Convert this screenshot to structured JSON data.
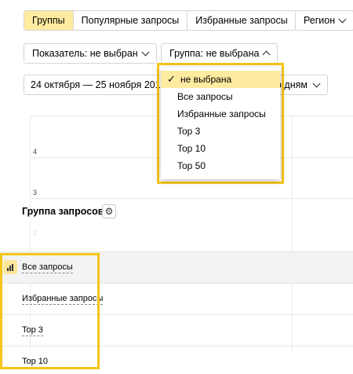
{
  "tabs": [
    {
      "label": "Группы",
      "active": true
    },
    {
      "label": "Популярные запросы",
      "active": false
    },
    {
      "label": "Избранные запросы",
      "active": false
    }
  ],
  "region_button": "Регион",
  "metric_button": "Показатель: не выбран",
  "group_button": "Группа: не выбрана",
  "date_range": "24 октября — 25 ноября 2019",
  "granularity_button_partial": "по дням",
  "chart": {
    "y_ticks": [
      "4",
      "3",
      "2"
    ]
  },
  "section_title": "Группа запросов",
  "rows": [
    {
      "label": "Все запросы",
      "selected": true
    },
    {
      "label": "Избранные запросы",
      "selected": false
    },
    {
      "label": "Top 3",
      "selected": false
    },
    {
      "label": "Top 10",
      "selected": false
    }
  ],
  "dropdown": {
    "items": [
      {
        "label": "не выбрана",
        "checked": true
      },
      {
        "label": "Все запросы",
        "checked": false
      },
      {
        "label": "Избранные запросы",
        "checked": false
      },
      {
        "label": "Top 3",
        "checked": false
      },
      {
        "label": "Top 10",
        "checked": false
      },
      {
        "label": "Top 50",
        "checked": false
      }
    ]
  },
  "colors": {
    "accent_yellow": "#ffeba0",
    "highlight_frame": "#f5c518"
  }
}
